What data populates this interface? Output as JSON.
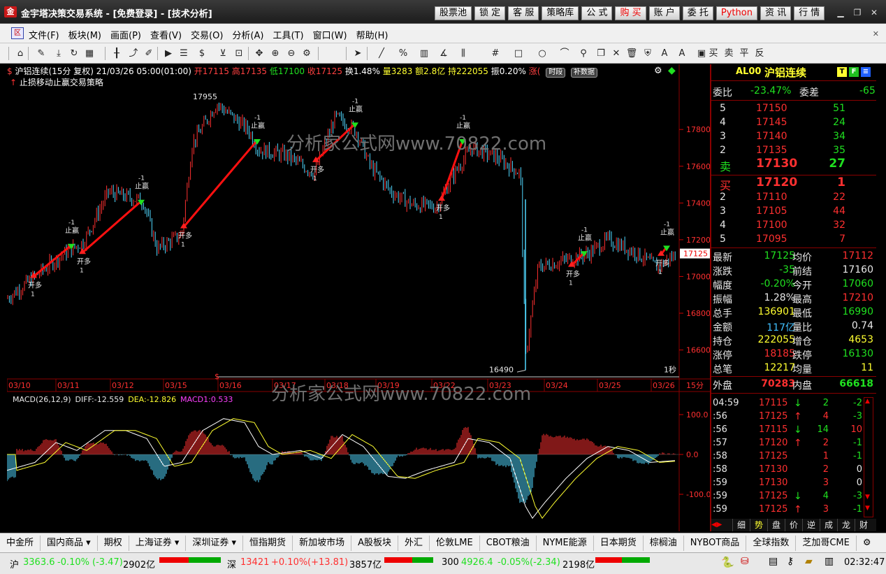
{
  "window": {
    "title": "金宇塔决策交易系统 - [免费登录] - [技术分析]",
    "logo_text": "金"
  },
  "top_buttons": [
    {
      "label": "股票池",
      "style": ""
    },
    {
      "label": "锁 定",
      "style": ""
    },
    {
      "label": "客 服",
      "style": ""
    },
    {
      "label": "策略库",
      "style": ""
    },
    {
      "label": "公 式",
      "style": ""
    },
    {
      "label": "购 买",
      "style": "red"
    },
    {
      "label": "账 户",
      "style": ""
    },
    {
      "label": "委 托",
      "style": ""
    },
    {
      "label": "Python",
      "style": "red"
    },
    {
      "label": "资 讯",
      "style": ""
    },
    {
      "label": "行 情",
      "style": ""
    }
  ],
  "menu": [
    "文件(F)",
    "板块(M)",
    "画面(P)",
    "查看(V)",
    "交易(O)",
    "分析(A)",
    "工具(T)",
    "窗口(W)",
    "帮助(H)"
  ],
  "toolbar_buttons": [
    {
      "name": "home-icon",
      "glyph": "⌂"
    },
    {
      "name": "pen-draw-icon",
      "glyph": "✎"
    },
    {
      "name": "download-icon",
      "glyph": "⤓"
    },
    {
      "name": "refresh-icon",
      "glyph": "↻"
    },
    {
      "name": "grid-layout-icon",
      "glyph": "▦"
    },
    {
      "name": "candlestick-icon",
      "glyph": "╂"
    },
    {
      "name": "trend-up-icon",
      "glyph": "⤴"
    },
    {
      "name": "edit-icon",
      "glyph": "✐"
    },
    {
      "name": "play-icon",
      "glyph": "▶"
    },
    {
      "name": "list-icon",
      "glyph": "☰"
    },
    {
      "name": "dollar-icon",
      "glyph": "$"
    },
    {
      "name": "filter-icon",
      "glyph": "⊻"
    },
    {
      "name": "zoom-fit-icon",
      "glyph": "⊡"
    },
    {
      "name": "move-icon",
      "glyph": "✥"
    },
    {
      "name": "zoom-in-icon",
      "glyph": "⊕"
    },
    {
      "name": "zoom-out-icon",
      "glyph": "⊖"
    },
    {
      "name": "settings-icon",
      "glyph": "⚙"
    },
    {
      "name": "cursor-icon",
      "glyph": "➤"
    },
    {
      "name": "line-tool-icon",
      "glyph": "╱"
    },
    {
      "name": "percent-icon",
      "glyph": "%"
    },
    {
      "name": "bars-icon",
      "glyph": "▥"
    },
    {
      "name": "angle-icon",
      "glyph": "∡"
    },
    {
      "name": "channel-icon",
      "glyph": "⫼"
    },
    {
      "name": "hash-icon",
      "glyph": "#"
    },
    {
      "name": "rect-icon",
      "glyph": "□"
    },
    {
      "name": "circle-icon",
      "glyph": "○"
    },
    {
      "name": "arc-icon",
      "glyph": "⌒"
    },
    {
      "name": "link-icon",
      "glyph": "⚲"
    },
    {
      "name": "copy-icon",
      "glyph": "❐"
    },
    {
      "name": "delete-icon",
      "glyph": "✕"
    },
    {
      "name": "trash-icon",
      "glyph": "🗑"
    },
    {
      "name": "lock-icon",
      "glyph": "⛨"
    },
    {
      "name": "text-icon",
      "glyph": "A"
    },
    {
      "name": "color-icon",
      "glyph": "A"
    },
    {
      "name": "save-icon",
      "glyph": "▣"
    }
  ],
  "toolbar_trade": [
    "买",
    "卖",
    "平",
    "反"
  ],
  "chart_info": {
    "symbol": "沪铝连续(15分 复权) 21/03/26 05:00(01:00)",
    "open": "开17115",
    "high": "高17135",
    "low": "低17100",
    "close": "收17125",
    "turnover_rate": "换1.48%",
    "volume": "量3283",
    "amount": "额2.8亿",
    "position": "持222055",
    "amplitude": "振0.20%",
    "change": "涨(",
    "tag1": "时段",
    "tag2": "补数据",
    "strategy": "止损移动止赢交易策略"
  },
  "axis": {
    "price_ticks": [
      "17800",
      "17600",
      "17400",
      "17200",
      "17000",
      "16800",
      "16600"
    ],
    "current_price": "17125",
    "dates": [
      "03/10",
      "03/11",
      "03/12",
      "03/15",
      "03/16",
      "03/17",
      "03/18",
      "03/19",
      "03/22",
      "03/23",
      "03/24",
      "03/25",
      "03/26"
    ],
    "period": "15分",
    "countdown": "1秒",
    "peak_label": "17955",
    "low_label": "16490",
    "dollar_marker": "$"
  },
  "signals": {
    "open_long": "开多",
    "stop_profit": "止赢",
    "qty_pos": "1",
    "qty_neg": "-1"
  },
  "watermark": "分析家公式网www.70822.com",
  "macd_info": {
    "name": "MACD(26,12,9)",
    "diff": "DIFF:-12.559",
    "dea": "DEA:-12.826",
    "macd": "MACD1:0.533"
  },
  "macd_axis": [
    "100.0",
    "0.0",
    "-100.0"
  ],
  "right_panel": {
    "code": "AL00",
    "name": "沪铝连续",
    "weibi_label": "委比",
    "weibi": "-23.47%",
    "weicha_label": "委差",
    "weicha": "-65",
    "asks": [
      {
        "level": "5",
        "price": "17150",
        "vol": "51"
      },
      {
        "level": "4",
        "price": "17145",
        "vol": "24"
      },
      {
        "level": "3",
        "price": "17140",
        "vol": "34"
      },
      {
        "level": "2",
        "price": "17135",
        "vol": "35"
      },
      {
        "level": "卖",
        "price": "17130",
        "vol": "27"
      }
    ],
    "bids": [
      {
        "level": "买",
        "price": "17120",
        "vol": "1"
      },
      {
        "level": "2",
        "price": "17110",
        "vol": "22"
      },
      {
        "level": "3",
        "price": "17105",
        "vol": "44"
      },
      {
        "level": "4",
        "price": "17100",
        "vol": "32"
      },
      {
        "level": "5",
        "price": "17095",
        "vol": "7"
      }
    ],
    "stats": [
      {
        "l1": "最新",
        "v1": "17125",
        "c1": "g",
        "l2": "均价",
        "v2": "17112",
        "c2": "r"
      },
      {
        "l1": "涨跌",
        "v1": "-35",
        "c1": "g",
        "l2": "前结",
        "v2": "17160",
        "c2": "w"
      },
      {
        "l1": "幅度",
        "v1": "-0.20%",
        "c1": "g",
        "l2": "今开",
        "v2": "17060",
        "c2": "g"
      },
      {
        "l1": "振幅",
        "v1": "1.28%",
        "c1": "w",
        "l2": "最高",
        "v2": "17210",
        "c2": "r"
      },
      {
        "l1": "总手",
        "v1": "136901",
        "c1": "y",
        "l2": "最低",
        "v2": "16990",
        "c2": "g"
      },
      {
        "l1": "金额",
        "v1": "117亿",
        "c1": "c",
        "l2": "量比",
        "v2": "0.74",
        "c2": "w"
      },
      {
        "l1": "持仓",
        "v1": "222055",
        "c1": "y",
        "l2": "增仓",
        "v2": "4653",
        "c2": "y"
      },
      {
        "l1": "涨停",
        "v1": "18185",
        "c1": "r",
        "l2": "跌停",
        "v2": "16130",
        "c2": "g"
      },
      {
        "l1": "总笔",
        "v1": "12217",
        "c1": "y",
        "l2": "均量",
        "v2": "11",
        "c2": "y"
      }
    ],
    "outer_label": "外盘",
    "outer": "70283",
    "inner_label": "内盘",
    "inner": "66618",
    "ticks": [
      {
        "time": "04:59",
        "price": "17115",
        "dir": "down",
        "vol": "2",
        "chg": "-2"
      },
      {
        "time": ":56",
        "price": "17125",
        "dir": "up",
        "vol": "4",
        "chg": "-3"
      },
      {
        "time": ":56",
        "price": "17115",
        "dir": "down",
        "vol": "14",
        "chg": "10"
      },
      {
        "time": ":57",
        "price": "17120",
        "dir": "up",
        "vol": "2",
        "chg": "-1"
      },
      {
        "time": ":58",
        "price": "17125",
        "dir": "",
        "vol": "1",
        "chg": "-1"
      },
      {
        "time": ":58",
        "price": "17130",
        "dir": "",
        "vol": "2",
        "chg": "0"
      },
      {
        "time": ":59",
        "price": "17130",
        "dir": "",
        "vol": "3",
        "chg": "0"
      },
      {
        "time": ":59",
        "price": "17125",
        "dir": "down",
        "vol": "4",
        "chg": "-3"
      },
      {
        "time": ":59",
        "price": "17125",
        "dir": "up",
        "vol": "3",
        "chg": "-1"
      }
    ],
    "tabs": [
      "细",
      "势",
      "盘",
      "价",
      "逆",
      "成",
      "龙",
      "财"
    ]
  },
  "market_tabs": [
    "中金所",
    "国内商品 ▾",
    "期权",
    "上海证券 ▾",
    "深圳证券 ▾",
    "恒指期货",
    "新加坡市场",
    "A股板块",
    "外汇",
    "伦敦LME",
    "CBOT粮油",
    "NYME能源",
    "日本期货",
    "棕榈油",
    "NYBOT商品",
    "全球指数",
    "芝加哥CME"
  ],
  "status": {
    "sh_label": "沪",
    "sh": "3363.6",
    "sh_chg": "-0.10%",
    "sh_abs": "(-3.47)",
    "sh_amt": "2902亿",
    "sz_label": "深",
    "sz": "13421",
    "sz_chg": "+0.10%",
    "sz_abs": "(+13.81)",
    "sz_amt": "3857亿",
    "hs_label": "300",
    "hs": "4926.4",
    "hs_chg": "-0.05%",
    "hs_abs": "(-2.34)",
    "hs_amt": "2198亿",
    "time": "02:32:47"
  }
}
